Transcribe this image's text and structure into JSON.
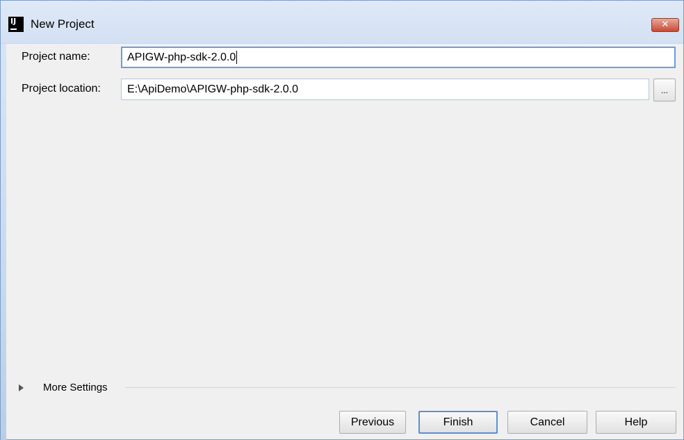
{
  "window": {
    "title": "New Project",
    "app_icon_text": "IJ",
    "close_glyph": "✕"
  },
  "form": {
    "project_name": {
      "label": "Project name:",
      "value": "APIGW-php-sdk-2.0.0"
    },
    "project_location": {
      "label": "Project location:",
      "value": "E:\\ApiDemo\\APIGW-php-sdk-2.0.0",
      "browse_label": "..."
    }
  },
  "more_settings": {
    "label": "More Settings",
    "expanded": false
  },
  "buttons": {
    "previous": "Previous",
    "finish": "Finish",
    "cancel": "Cancel",
    "help": "Help"
  },
  "icons": {
    "app": "intellij-idea-icon",
    "close": "close-icon",
    "expand": "triangle-right-icon"
  }
}
